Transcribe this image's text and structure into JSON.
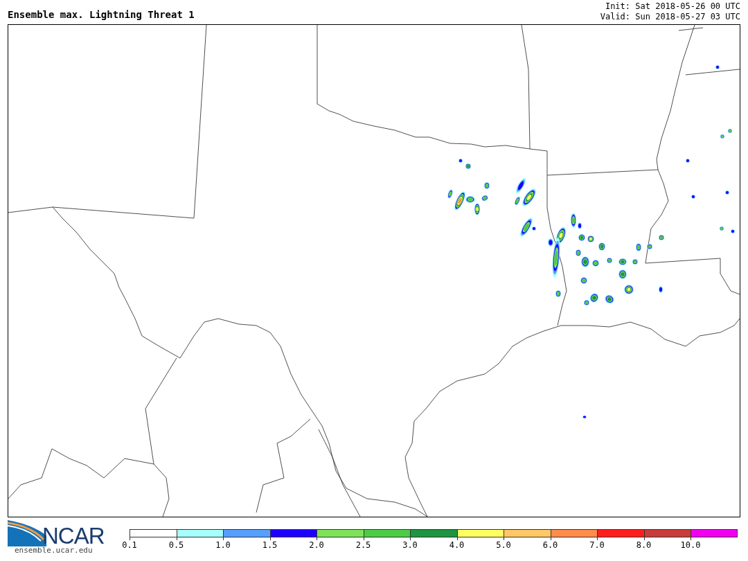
{
  "header": {
    "title": "Ensemble max. Lightning Threat 1",
    "init": "Init: Sat 2018-05-26 00 UTC",
    "valid": "Valid: Sun 2018-05-27 03 UTC"
  },
  "logo": {
    "name": "NCAR",
    "url": "ensemble.ucar.edu"
  },
  "colorbar": [
    {
      "label": "0.1",
      "color": "#ffffff"
    },
    {
      "label": "0.5",
      "color": "#a6ffff"
    },
    {
      "label": "1.0",
      "color": "#55a0ff"
    },
    {
      "label": "1.5",
      "color": "#1e00ff"
    },
    {
      "label": "2.0",
      "color": "#7ee35a"
    },
    {
      "label": "2.5",
      "color": "#4ccc44"
    },
    {
      "label": "3.0",
      "color": "#1e9641"
    },
    {
      "label": "4.0",
      "color": "#ffff64"
    },
    {
      "label": "5.0",
      "color": "#ffc864"
    },
    {
      "label": "6.0",
      "color": "#ff8c4b"
    },
    {
      "label": "7.0",
      "color": "#ff1e1e"
    },
    {
      "label": "8.0",
      "color": "#c83c3c"
    },
    {
      "label": "10.0",
      "color": "#f000f0"
    }
  ]
}
